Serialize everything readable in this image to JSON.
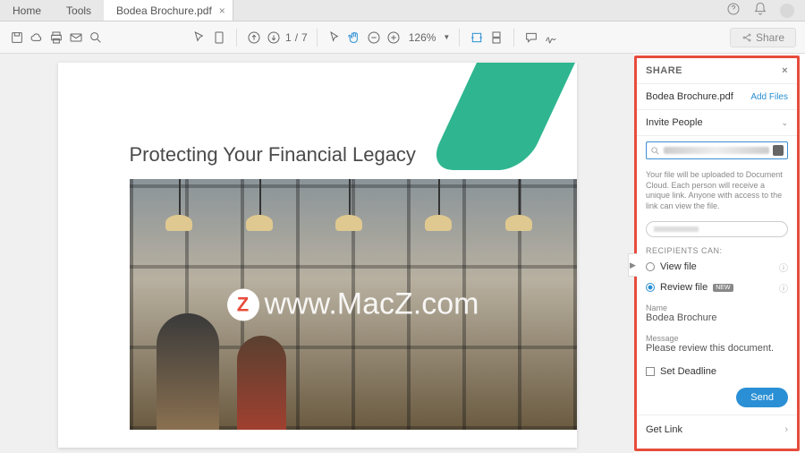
{
  "tabs": {
    "home": "Home",
    "tools": "Tools",
    "document": "Bodea Brochure.pdf"
  },
  "toolbar": {
    "page_current": "1",
    "page_sep": "/",
    "page_total": "7",
    "zoom": "126%",
    "share_button": "Share"
  },
  "document": {
    "title": "Protecting Your Financial Legacy"
  },
  "watermark": {
    "badge": "Z",
    "text": "www.MacZ.com"
  },
  "share": {
    "header": "SHARE",
    "filename": "Bodea Brochure.pdf",
    "add_files": "Add Files",
    "invite_label": "Invite People",
    "upload_note": "Your file will be uploaded to Document Cloud. Each person will receive a unique link. Anyone with access to the link can view the file.",
    "recipients_label": "RECIPIENTS CAN:",
    "view_option": "View file",
    "review_option": "Review file",
    "new_badge": "NEW",
    "name_label": "Name",
    "name_value": "Bodea Brochure",
    "message_label": "Message",
    "message_value": "Please review this document.",
    "deadline_label": "Set Deadline",
    "send_button": "Send",
    "get_link": "Get Link"
  }
}
